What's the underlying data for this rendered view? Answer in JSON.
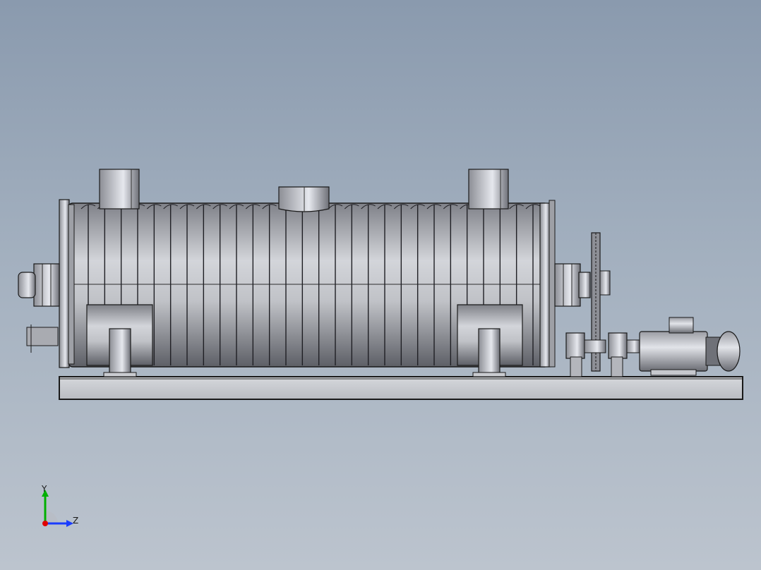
{
  "viewport": {
    "background_top": "#8a9aae",
    "background_bottom": "#bcc4ce"
  },
  "model": {
    "description_icon": "rotary-dryer-assembly-icon",
    "body_color": "#b4b6bc",
    "outline_color": "#1a1a1a",
    "fin_count": 28
  },
  "triad": {
    "y_label": "Y",
    "z_label": "Z",
    "y_color": "#00b000",
    "z_color": "#1a3cff",
    "x_color": "#e00000"
  }
}
